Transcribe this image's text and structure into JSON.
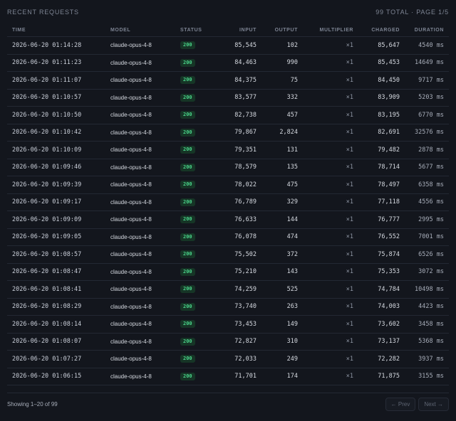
{
  "header": {
    "title": "RECENT REQUESTS",
    "meta": "99 TOTAL · PAGE 1/5"
  },
  "columns": {
    "time": "TIME",
    "model": "MODEL",
    "status": "STATUS",
    "input": "INPUT",
    "output": "OUTPUT",
    "multiplier": "MULTIPLIER",
    "charged": "CHARGED",
    "duration": "DURATION"
  },
  "rows": [
    {
      "time": "2026-06-20 01:14:28",
      "model": "claude-opus-4-8",
      "status": "200",
      "input": "85,545",
      "output": "102",
      "multiplier": "×1",
      "charged": "85,647",
      "duration": "4540 ms"
    },
    {
      "time": "2026-06-20 01:11:23",
      "model": "claude-opus-4-8",
      "status": "200",
      "input": "84,463",
      "output": "990",
      "multiplier": "×1",
      "charged": "85,453",
      "duration": "14649 ms"
    },
    {
      "time": "2026-06-20 01:11:07",
      "model": "claude-opus-4-8",
      "status": "200",
      "input": "84,375",
      "output": "75",
      "multiplier": "×1",
      "charged": "84,450",
      "duration": "9717 ms"
    },
    {
      "time": "2026-06-20 01:10:57",
      "model": "claude-opus-4-8",
      "status": "200",
      "input": "83,577",
      "output": "332",
      "multiplier": "×1",
      "charged": "83,909",
      "duration": "5203 ms"
    },
    {
      "time": "2026-06-20 01:10:50",
      "model": "claude-opus-4-8",
      "status": "200",
      "input": "82,738",
      "output": "457",
      "multiplier": "×1",
      "charged": "83,195",
      "duration": "6770 ms"
    },
    {
      "time": "2026-06-20 01:10:42",
      "model": "claude-opus-4-8",
      "status": "200",
      "input": "79,867",
      "output": "2,824",
      "multiplier": "×1",
      "charged": "82,691",
      "duration": "32576 ms"
    },
    {
      "time": "2026-06-20 01:10:09",
      "model": "claude-opus-4-8",
      "status": "200",
      "input": "79,351",
      "output": "131",
      "multiplier": "×1",
      "charged": "79,482",
      "duration": "2878 ms"
    },
    {
      "time": "2026-06-20 01:09:46",
      "model": "claude-opus-4-8",
      "status": "200",
      "input": "78,579",
      "output": "135",
      "multiplier": "×1",
      "charged": "78,714",
      "duration": "5677 ms"
    },
    {
      "time": "2026-06-20 01:09:39",
      "model": "claude-opus-4-8",
      "status": "200",
      "input": "78,022",
      "output": "475",
      "multiplier": "×1",
      "charged": "78,497",
      "duration": "6358 ms"
    },
    {
      "time": "2026-06-20 01:09:17",
      "model": "claude-opus-4-8",
      "status": "200",
      "input": "76,789",
      "output": "329",
      "multiplier": "×1",
      "charged": "77,118",
      "duration": "4556 ms"
    },
    {
      "time": "2026-06-20 01:09:09",
      "model": "claude-opus-4-8",
      "status": "200",
      "input": "76,633",
      "output": "144",
      "multiplier": "×1",
      "charged": "76,777",
      "duration": "2995 ms"
    },
    {
      "time": "2026-06-20 01:09:05",
      "model": "claude-opus-4-8",
      "status": "200",
      "input": "76,078",
      "output": "474",
      "multiplier": "×1",
      "charged": "76,552",
      "duration": "7001 ms"
    },
    {
      "time": "2026-06-20 01:08:57",
      "model": "claude-opus-4-8",
      "status": "200",
      "input": "75,502",
      "output": "372",
      "multiplier": "×1",
      "charged": "75,874",
      "duration": "6526 ms"
    },
    {
      "time": "2026-06-20 01:08:47",
      "model": "claude-opus-4-8",
      "status": "200",
      "input": "75,210",
      "output": "143",
      "multiplier": "×1",
      "charged": "75,353",
      "duration": "3072 ms"
    },
    {
      "time": "2026-06-20 01:08:41",
      "model": "claude-opus-4-8",
      "status": "200",
      "input": "74,259",
      "output": "525",
      "multiplier": "×1",
      "charged": "74,784",
      "duration": "10498 ms"
    },
    {
      "time": "2026-06-20 01:08:29",
      "model": "claude-opus-4-8",
      "status": "200",
      "input": "73,740",
      "output": "263",
      "multiplier": "×1",
      "charged": "74,003",
      "duration": "4423 ms"
    },
    {
      "time": "2026-06-20 01:08:14",
      "model": "claude-opus-4-8",
      "status": "200",
      "input": "73,453",
      "output": "149",
      "multiplier": "×1",
      "charged": "73,602",
      "duration": "3458 ms"
    },
    {
      "time": "2026-06-20 01:08:07",
      "model": "claude-opus-4-8",
      "status": "200",
      "input": "72,827",
      "output": "310",
      "multiplier": "×1",
      "charged": "73,137",
      "duration": "5368 ms"
    },
    {
      "time": "2026-06-20 01:07:27",
      "model": "claude-opus-4-8",
      "status": "200",
      "input": "72,033",
      "output": "249",
      "multiplier": "×1",
      "charged": "72,282",
      "duration": "3937 ms"
    },
    {
      "time": "2026-06-20 01:06:15",
      "model": "claude-opus-4-8",
      "status": "200",
      "input": "71,701",
      "output": "174",
      "multiplier": "×1",
      "charged": "71,875",
      "duration": "3155 ms"
    }
  ],
  "footer": {
    "showing": "Showing 1–20 of 99",
    "prev_label": "← Prev",
    "next_label": "Next →"
  },
  "colors": {
    "background": "#13161d",
    "status_ok_bg": "#163526",
    "status_ok_fg": "#4ad58a"
  }
}
